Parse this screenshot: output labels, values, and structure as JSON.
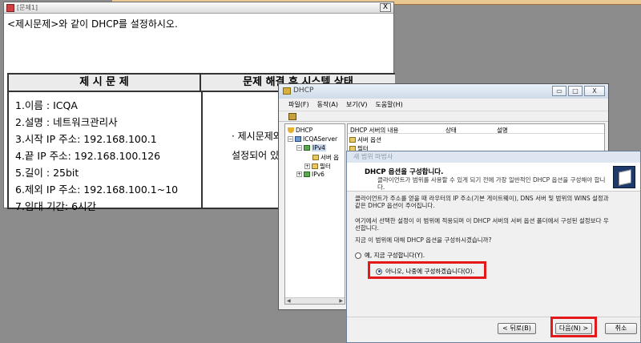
{
  "problem_window": {
    "title": "[문제1]",
    "close_glyph": "X",
    "instruction": "<제시문제>와 같이 DHCP를 설정하시오.",
    "left_header": "제 시 문 제",
    "right_header": "문제 해결 후 시스템 상태",
    "items": [
      "1.이름 : ICQA",
      "2.설명 : 네트워크관리사",
      "3.시작 IP 주소: 192.168.100.1",
      "4.끝 IP 주소: 192.168.100.126",
      "5.길이 : 25bit",
      "6.제외 IP 주소: 192.168.100.1~10",
      "7.임대 기간: 6시간"
    ],
    "status_line1": "· 제시문제와",
    "status_line2": "설정되어 있"
  },
  "dhcp_window": {
    "title": "DHCP",
    "controls": [
      "▭",
      "□",
      "X"
    ],
    "menus": [
      "파일(F)",
      "동작(A)",
      "보기(V)",
      "도움말(H)"
    ],
    "tree": {
      "root": "DHCP",
      "server": "ICQAServer",
      "ipv4": "IPv4",
      "server_options": "서버 옵",
      "filter": "필터",
      "ipv6": "IPv6",
      "expand": "+",
      "collapse": "−"
    },
    "columns": [
      "DHCP 서버의 내용",
      "상태",
      "설명"
    ],
    "rows": [
      "서버 옵션",
      "필터"
    ],
    "scroll_left": "◀",
    "scroll_right": "▶"
  },
  "wizard": {
    "title": "새 범위 마법사",
    "heading": "DHCP 옵션을 구성합니다.",
    "subheading": "클라이언트가 범위를 사용할 수 있게 되기 전에 가장 일반적인 DHCP 옵션을 구성해야 합니다.",
    "paragraph1": "클라이언트가 주소를 얻을 때 라우터의 IP 주소(기본 게이트웨이), DNS 서버 및 범위의 WINS 설정과 같은 DHCP 옵션이 주어집니다.",
    "paragraph2": "여기에서 선택한 설정이 이 범위에 적용되며 이 DHCP 서버의 서버 옵션 폴더에서 구성된 설정보다 우선합니다.",
    "question": "지금 이 범위에 대해 DHCP 옵션을 구성하시겠습니까?",
    "option_yes": "예, 지금 구성합니다(Y).",
    "option_no": "아니오, 나중에 구성하겠습니다(O).",
    "selected_option": "option_no",
    "back_button": "< 뒤로(B)",
    "next_button": "다음(N) >",
    "cancel_button": "취소"
  },
  "highlight_color": "#e41a1a"
}
